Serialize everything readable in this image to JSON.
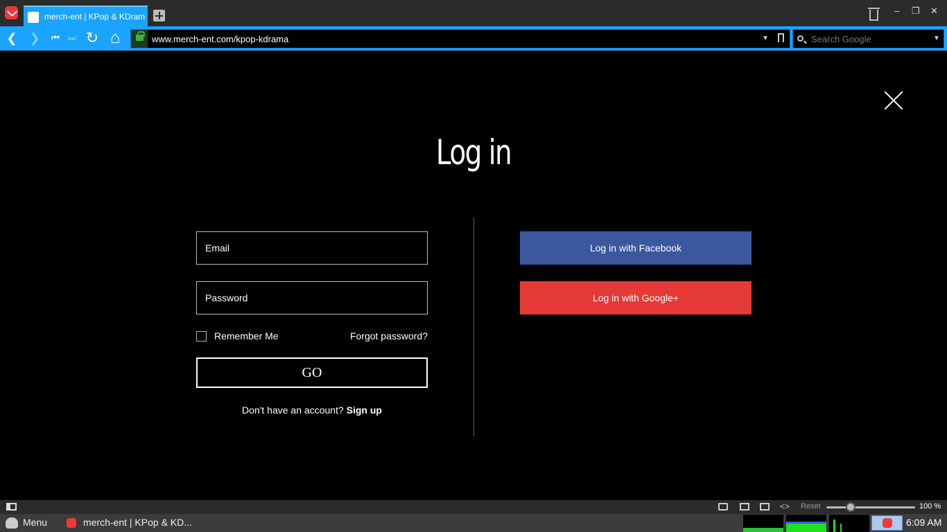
{
  "browser": {
    "tab_title": "merch-ent | KPop & KDrama",
    "url": "www.merch-ent.com/kpop-kdrama",
    "search_placeholder": "Search Google",
    "window_minimize": "–",
    "window_restore": "❐",
    "window_close": "✕",
    "nav_back": "❮",
    "nav_forward": "❯",
    "nav_first": "⏮",
    "nav_last": "⏭",
    "nav_reload": "↻",
    "nav_home": "⌂"
  },
  "page": {
    "title": "Log in",
    "email_placeholder": "Email",
    "password_placeholder": "Password",
    "remember_label": "Remember Me",
    "forgot_label": "Forgot password?",
    "go_label": "GO",
    "signup_prompt": "Don't have an account?",
    "signup_link": "Sign up",
    "facebook_label": "Log in with Facebook",
    "google_label": "Log in with Google+",
    "colors": {
      "facebook": "#3b579d",
      "google": "#e53935",
      "accent": "#1aa3ff"
    }
  },
  "statusbar": {
    "reset_label": "Reset",
    "zoom_label": "100 %",
    "zoom_level": 0.27
  },
  "taskbar": {
    "menu_label": "Menu",
    "task_title": "merch-ent | KPop & KD...",
    "clock": "6:09 AM"
  }
}
